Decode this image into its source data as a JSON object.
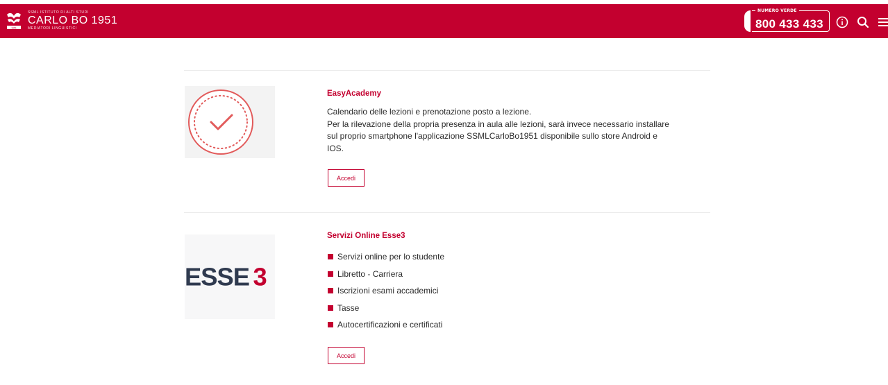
{
  "header": {
    "logo_small_top": "SSML ISTITUTO DI ALTI STUDI",
    "logo_name": "CARLO BO 1951",
    "logo_small_bottom": "MEDIATORI LINGUISTICI",
    "phone_label": "NUMERO VERDE",
    "phone_number": "800 433 433",
    "icons": [
      "info-icon",
      "search-icon",
      "menu-icon"
    ]
  },
  "cards": [
    {
      "title": "EasyAcademy",
      "description_lines": [
        "Calendario delle lezioni e prenotazione posto a lezione.",
        "Per la rilevazione della propria presenza in aula alle lezioni, sarà invece necessario installare",
        "sul proprio smartphone l'applicazione SSMLCarloBo1951 disponibile sullo store Android e",
        "IOS."
      ],
      "button_label": "Accedi",
      "image_icon": "checkmark-badge-icon"
    },
    {
      "title": "Servizi Online Esse3",
      "logo_text": "ESSE 3",
      "bullets": [
        "Servizi online per lo studente",
        "Libretto - Carriera",
        "Iscrizioni esami accademici",
        "Tasse",
        "Autocertificazioni e certificati"
      ],
      "button_label": "Accedi"
    }
  ],
  "colors": {
    "brand_red": "#c3002f",
    "esse_blue": "#2f3a4f",
    "divider": "#ebebeb"
  }
}
